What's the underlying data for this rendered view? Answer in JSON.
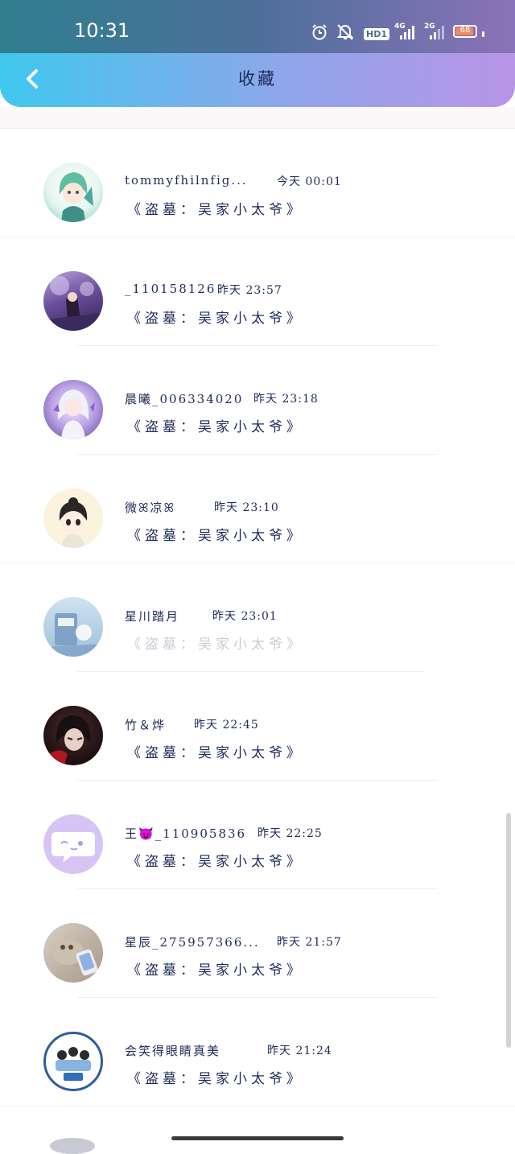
{
  "status_bar": {
    "time": "10:31",
    "icons": [
      "alarm-icon",
      "mute-icon",
      "hd-icon",
      "signal-4g-icon",
      "signal-2g-icon",
      "battery-icon"
    ],
    "hd_label": "HD1",
    "net1": "4G",
    "net2": "2G",
    "battery": "68"
  },
  "header": {
    "title": "收藏",
    "back_icon": "chevron-left-icon"
  },
  "items": [
    {
      "name": "tommyfhilnfig...",
      "time": "今天 00:01",
      "book": "《盗墓：吴家小太爷》"
    },
    {
      "name": "_110158126",
      "time": "昨天 23:57",
      "book": "《盗墓：吴家小太爷》"
    },
    {
      "name": "晨曦_006334020",
      "time": "昨天 23:18",
      "book": "《盗墓：吴家小太爷》"
    },
    {
      "name": "微ꕤ凉ꕤ",
      "time": "昨天 23:10",
      "book": "《盗墓：吴家小太爷》"
    },
    {
      "name": "星川踏月",
      "time": "昨天 23:01",
      "book": "《盗墓：吴家小太爷》"
    },
    {
      "name": "竹＆烨",
      "time": "昨天 22:45",
      "book": "《盗墓：吴家小太爷》"
    },
    {
      "name": "王😈_110905836",
      "time": "昨天 22:25",
      "book": "《盗墓：吴家小太爷》"
    },
    {
      "name": "星辰_275957366...",
      "time": "昨天 21:57",
      "book": "《盗墓：吴家小太爷》"
    },
    {
      "name": "会笑得眼睛真美",
      "time": "昨天 21:24",
      "book": "《盗墓：吴家小太爷》"
    }
  ],
  "colors": {
    "header_start": "#3fc8ee",
    "header_end": "#b894e6",
    "text": "#1f2b57"
  }
}
